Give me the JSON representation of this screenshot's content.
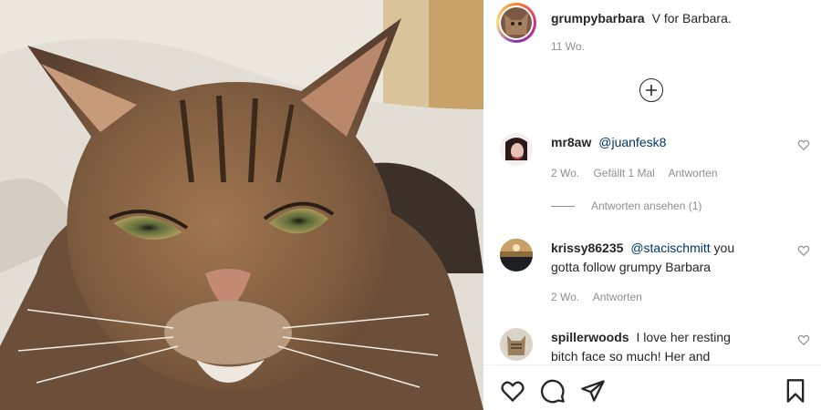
{
  "post": {
    "username": "grumpybarbara",
    "caption": "V for Barbara.",
    "time": "11 Wo."
  },
  "comments": [
    {
      "username": "mr8aw",
      "mention": "@juanfesk8",
      "text": "",
      "time": "2 Wo.",
      "likes": "Gefällt 1 Mal",
      "reply": "Antworten"
    },
    {
      "username": "krissy86235",
      "mention": "@stacischmitt",
      "text": "you gotta follow grumpy Barbara",
      "time": "2 Wo.",
      "reply": "Antworten"
    },
    {
      "username": "spillerwoods",
      "mention": "",
      "text": "I love her resting bitch face so much! Her and"
    }
  ],
  "view_replies": "Antworten ansehen (1)",
  "icons": {
    "load_more": "plus-circle-icon",
    "comment_like": "heart-outline-icon",
    "action_like": "heart-outline-icon",
    "action_comment": "speech-bubble-icon",
    "action_share": "paper-plane-icon",
    "action_save": "bookmark-icon"
  },
  "colors": {
    "text": "#262626",
    "secondary": "#8e8e8e",
    "mention": "#00376b"
  }
}
